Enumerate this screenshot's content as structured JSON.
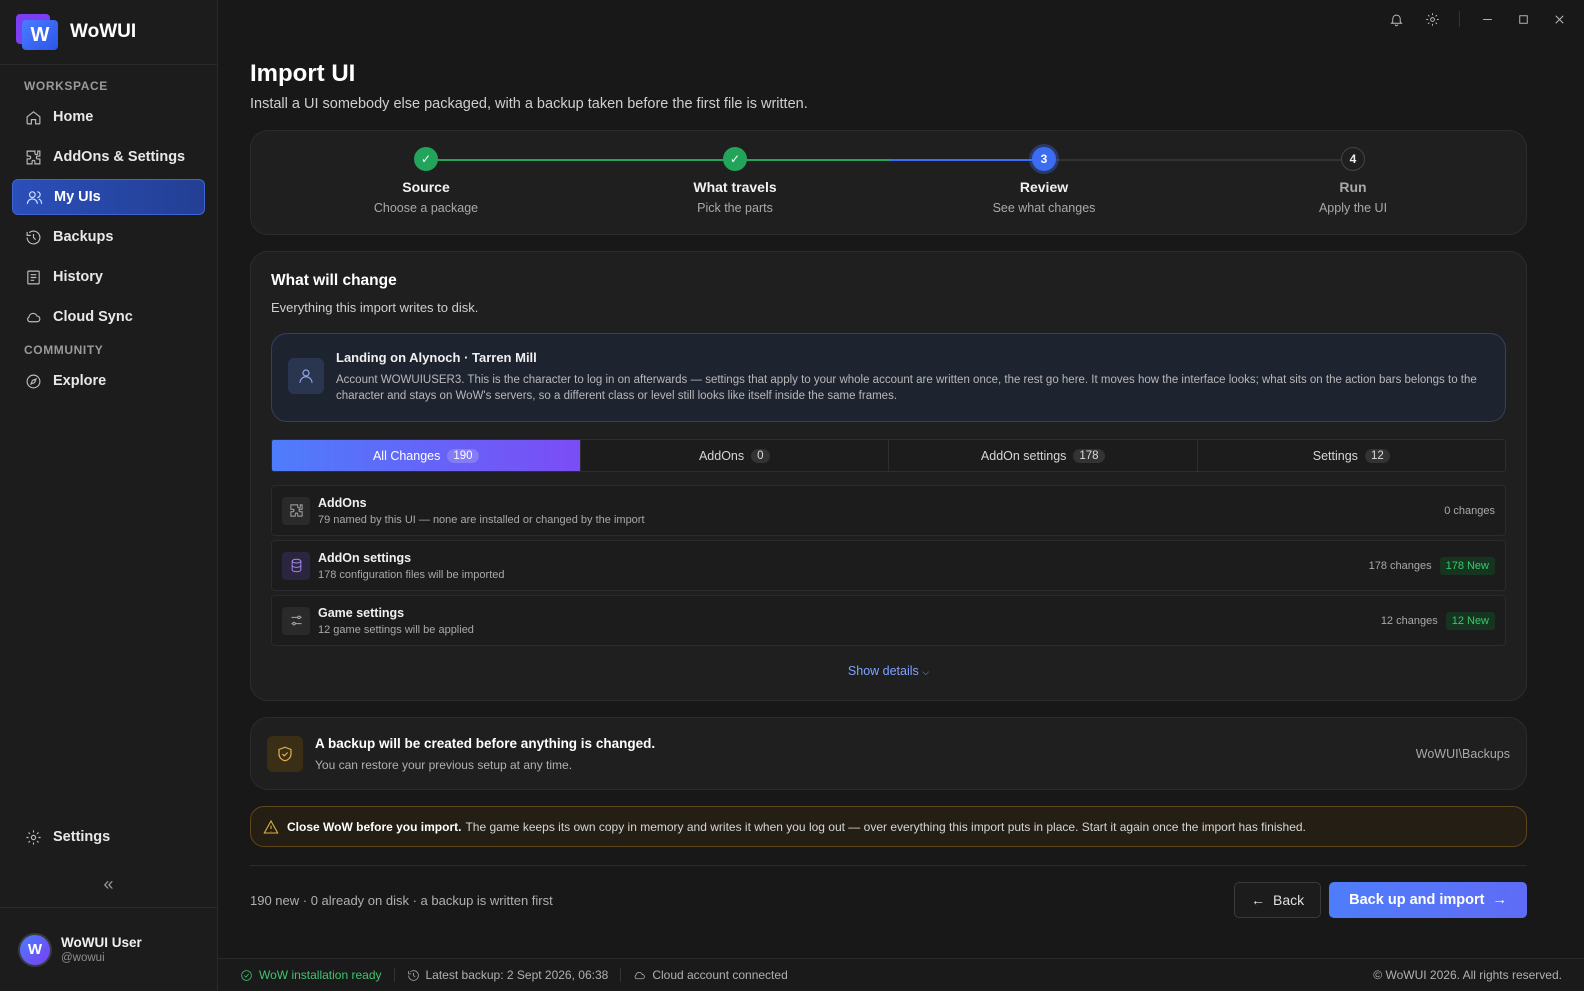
{
  "brand": {
    "name": "WoWUI",
    "logo_letter": "W"
  },
  "sidebar": {
    "sections": [
      {
        "title": "WORKSPACE"
      },
      {
        "title": "COMMUNITY"
      }
    ],
    "items": [
      {
        "label": "Home",
        "icon": "home-icon"
      },
      {
        "label": "AddOns & Settings",
        "icon": "puzzle-icon"
      },
      {
        "label": "My UIs",
        "icon": "users-icon",
        "active": true
      },
      {
        "label": "Backups",
        "icon": "history-icon"
      },
      {
        "label": "History",
        "icon": "list-icon"
      },
      {
        "label": "Cloud Sync",
        "icon": "cloud-icon"
      },
      {
        "label": "Explore",
        "icon": "compass-icon"
      }
    ],
    "settings_label": "Settings",
    "collapse_glyph": "«",
    "user": {
      "name": "WoWUI User",
      "handle": "@wowui"
    }
  },
  "page": {
    "title": "Import UI",
    "subtitle": "Install a UI somebody else packaged, with a backup taken before the first file is written."
  },
  "stepper": {
    "steps": [
      {
        "label": "Source",
        "desc": "Choose a package",
        "state": "done"
      },
      {
        "label": "What travels",
        "desc": "Pick the parts",
        "state": "done"
      },
      {
        "label": "Review",
        "desc": "See what changes",
        "state": "current",
        "num": "3"
      },
      {
        "label": "Run",
        "desc": "Apply the UI",
        "state": "todo",
        "num": "4"
      }
    ]
  },
  "changes": {
    "title": "What will change",
    "subtitle": "Everything this import writes to disk.",
    "landing": {
      "title": "Landing on Alynoch · Tarren Mill",
      "body": "Account WOWUIUSER3. This is the character to log in on afterwards — settings that apply to your whole account are written once, the rest go here. It moves how the interface looks; what sits on the action bars belongs to the character and stays on WoW's servers, so a different class or level still looks like itself inside the same frames."
    },
    "tabs": [
      {
        "label": "All Changes",
        "count": "190",
        "active": true
      },
      {
        "label": "AddOns",
        "count": "0"
      },
      {
        "label": "AddOn settings",
        "count": "178"
      },
      {
        "label": "Settings",
        "count": "12"
      }
    ],
    "rows": [
      {
        "title": "AddOns",
        "sub": "79 named by this UI — none are installed or changed by the import",
        "count": "0 changes",
        "new": ""
      },
      {
        "title": "AddOn settings",
        "sub": "178 configuration files will be imported",
        "count": "178 changes",
        "new": "178 New"
      },
      {
        "title": "Game settings",
        "sub": "12 game settings will be applied",
        "count": "12 changes",
        "new": "12 New"
      }
    ],
    "show_details": "Show details"
  },
  "backup": {
    "title": "A backup will be created before anything is changed.",
    "subtitle": "You can restore your previous setup at any time.",
    "path": "WoWUI\\Backups"
  },
  "warning": {
    "bold": "Close WoW before you import.",
    "text": "The game keeps its own copy in memory and writes it when you log out — over everything this import puts in place. Start it again once the import has finished."
  },
  "footer": {
    "summary": "190 new · 0 already on disk · a backup is written first",
    "back_label": "Back",
    "primary_label": "Back up and import"
  },
  "statusbar": {
    "install": "WoW installation ready",
    "backup": "Latest backup: 2 Sept 2026, 06:38",
    "cloud": "Cloud account connected",
    "copyright": "© WoWUI 2026. All rights reserved."
  },
  "colors": {
    "accent": "#4e7dfb",
    "success": "#22a55a",
    "warning": "#e4b04a"
  }
}
